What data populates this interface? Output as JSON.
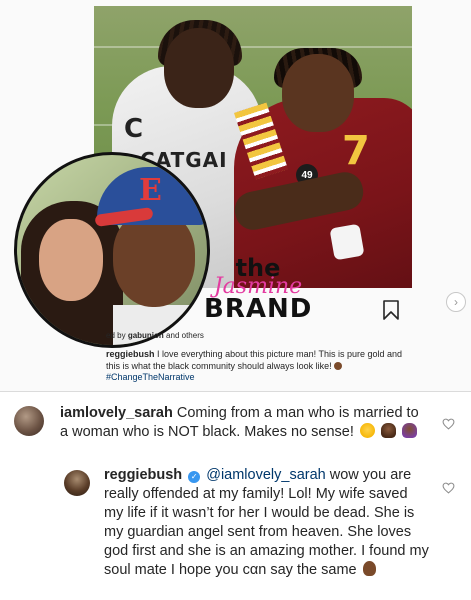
{
  "post": {
    "photo_jersey_number": "7",
    "photo_badge": "49",
    "photo_jersey_text": "CATGAI",
    "avatar_cap_letter": "E",
    "watermark": {
      "line1": "the",
      "line2": "Jasmine",
      "line3": "BRAND"
    },
    "liked_by_prefix": "ed by",
    "liked_by_user": "gabunion",
    "liked_by_suffix": "and others",
    "caption_user": "reggiebush",
    "caption_text": "I love everything about this picture man! This is pure gold and this is what the black community should always look like!",
    "caption_hashtag": "#ChangeTheNarrative",
    "icons": {
      "save": "bookmark-icon",
      "next": "chevron-right-icon"
    }
  },
  "comments": [
    {
      "username": "iamlovely_sarah",
      "text": "Coming from a man who is married to a woman who is NOT black. Makes no sense!",
      "emojis": [
        "flushed-face",
        "woman-facepalming",
        "woman-tipping-hand"
      ]
    },
    {
      "username": "reggiebush",
      "verified": true,
      "mention": "@iamlovely_sarah",
      "text": "wow you are really offended at my family! Lol! My wife saved my life if it wasn’t for her I would be dead. She is my guardian angel sent from heaven. She loves god first and she is an amazing mother. I found my soul mate I hope you cαn say the same",
      "emojis": [
        "folded-hands"
      ]
    }
  ],
  "colors": {
    "link": "#00376b",
    "verified": "#3897f0",
    "watermark_pink": "#e33ba0"
  }
}
